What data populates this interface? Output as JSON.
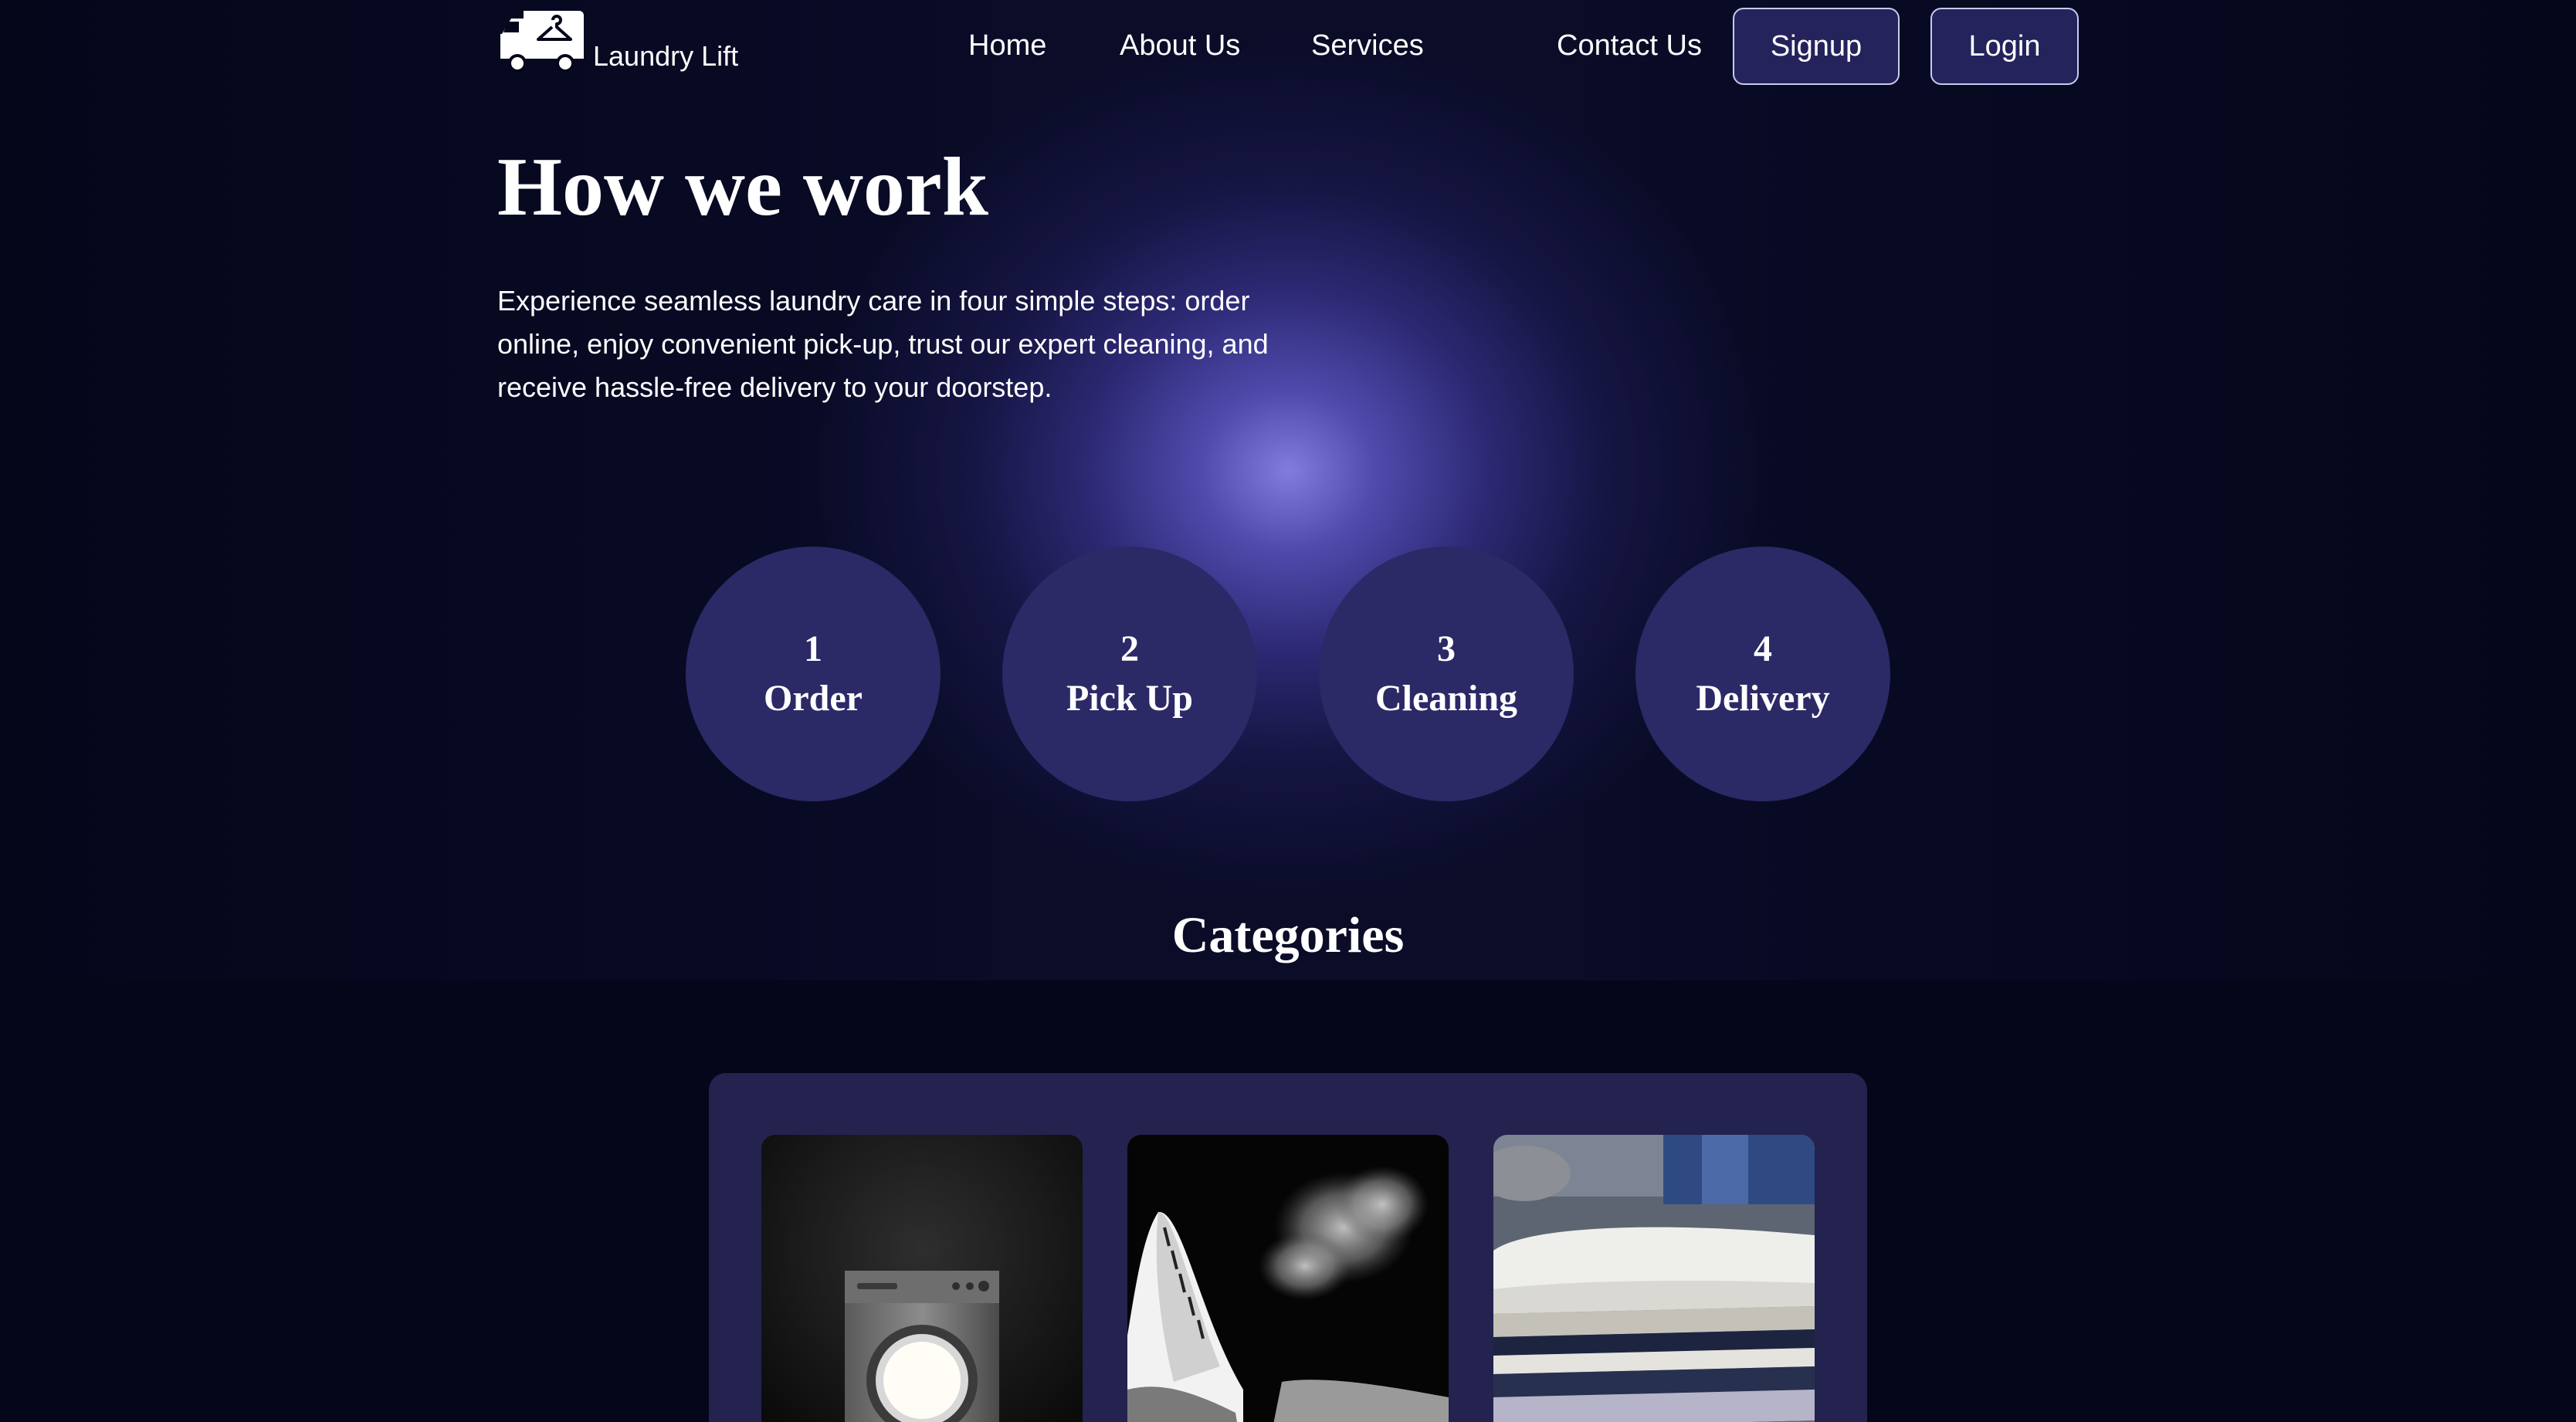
{
  "brand": {
    "name": "Laundry Lift",
    "logo_icon": "truck-hanger-icon"
  },
  "nav": {
    "links": [
      "Home",
      "About Us",
      "Services",
      "Contact Us"
    ],
    "signup_label": "Signup",
    "login_label": "Login"
  },
  "hero": {
    "title": "How we work",
    "description": "Experience seamless laundry care in four simple steps: order online, enjoy convenient pick-up, trust our expert cleaning, and receive hassle-free delivery to your doorstep."
  },
  "steps": [
    {
      "number": "1",
      "label": "Order"
    },
    {
      "number": "2",
      "label": "Pick Up"
    },
    {
      "number": "3",
      "label": "Cleaning"
    },
    {
      "number": "4",
      "label": "Delivery"
    }
  ],
  "categories": {
    "title": "Categories",
    "cards": [
      {
        "image": "washing-machine-image"
      },
      {
        "image": "steam-iron-image"
      },
      {
        "image": "folded-clothes-image"
      }
    ]
  },
  "colors": {
    "background": "#04061a",
    "glow": "#827ddc",
    "step_circle": "#2b2966",
    "panel": "#24224f",
    "button": "#25235c"
  }
}
